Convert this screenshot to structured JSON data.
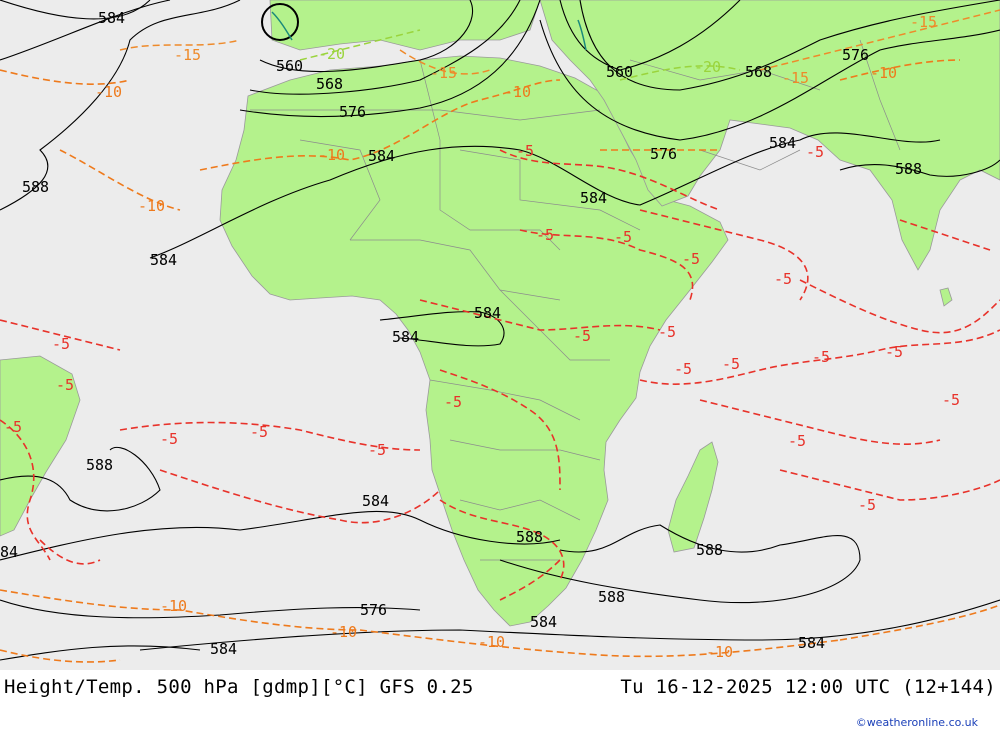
{
  "footer": {
    "title": "Height/Temp. 500 hPa [gdmp][°C] GFS 0.25",
    "valid_time": "Tu 16-12-2025 12:00 UTC (12+144)",
    "credit": "©weatheronline.co.uk"
  },
  "colors": {
    "ocean": "#ececec",
    "land": "#b4f28c",
    "height_contour": "#000000",
    "temp_minus5": "#e8322a",
    "temp_minus10": "#ee7a1c",
    "temp_minus15": "#ee8a2a",
    "temp_minus20": "#9ad43c",
    "credit_link": "#1a3fb8"
  },
  "map": {
    "region": "Africa",
    "height_labels": [
      "584",
      "560",
      "568",
      "576",
      "584",
      "576",
      "584",
      "588",
      "584",
      "584",
      "584",
      "588",
      "584",
      "588",
      "588",
      "576",
      "584",
      "584",
      "588",
      "588",
      "584",
      "584",
      "560",
      "568",
      "576",
      "84"
    ],
    "temp_labels": [
      "-15",
      "-10",
      "-10",
      "-10",
      "-10",
      "-5",
      "-5",
      "-5",
      "-5",
      "-5",
      "-5",
      "-5",
      "-5",
      "-5",
      "-5",
      "-5",
      "-5",
      "-5",
      "-5",
      "-5",
      "-5",
      "-5",
      "-5",
      "-5",
      "-5",
      "-5",
      "-5",
      "-10",
      "-10",
      "-10",
      "-10",
      "-20",
      "-15",
      "-15",
      "-15",
      "-10",
      "-20"
    ]
  }
}
